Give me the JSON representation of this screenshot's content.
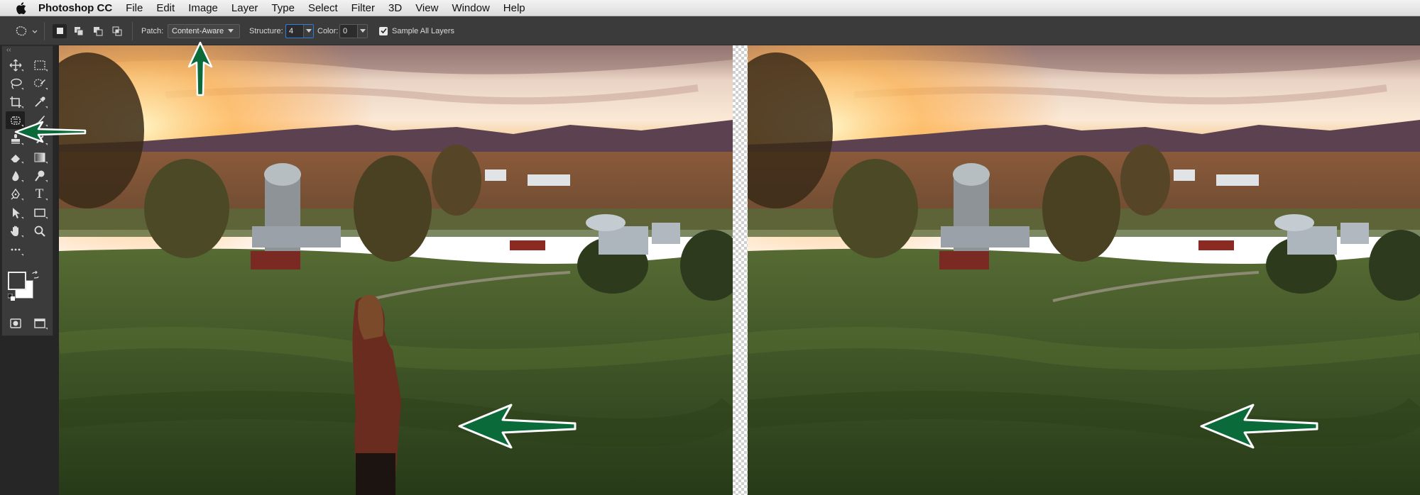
{
  "menubar": {
    "app_name": "Photoshop CC",
    "items": [
      "File",
      "Edit",
      "Image",
      "Layer",
      "Type",
      "Select",
      "Filter",
      "3D",
      "View",
      "Window",
      "Help"
    ]
  },
  "options": {
    "patch_label": "Patch:",
    "patch_value": "Content-Aware",
    "structure_label": "Structure:",
    "structure_value": "4",
    "color_label": "Color:",
    "color_value": "0",
    "sample_all_layers_label": "Sample All Layers",
    "sample_all_layers_checked": true
  },
  "tools": {
    "active": "patch-tool",
    "type_tool_glyph": "T",
    "collapse_glyph": "‹‹"
  },
  "colors": {
    "annotation_arrow_fill": "#0b6a3a",
    "annotation_arrow_outline": "#ffffff",
    "ui_dark": "#3b3b3b",
    "focus_blue": "#2f7de1"
  }
}
